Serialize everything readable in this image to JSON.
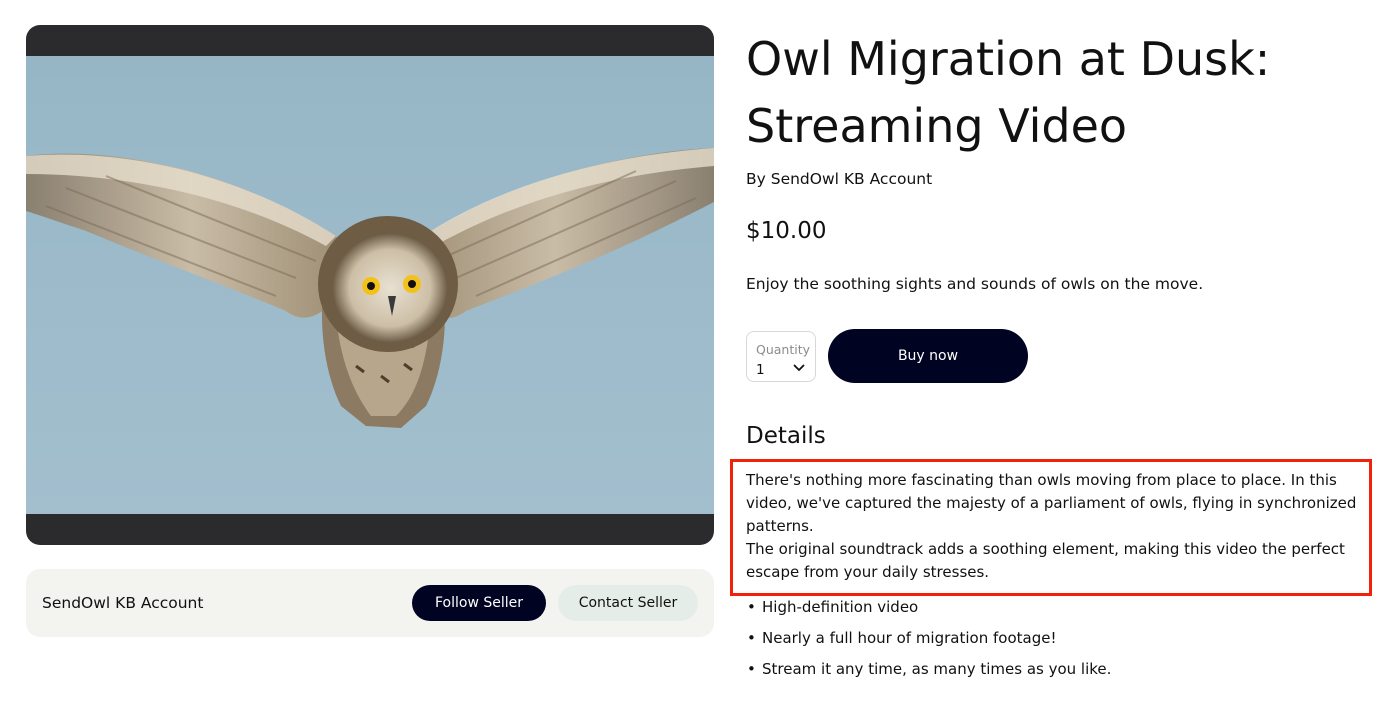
{
  "product": {
    "title": "Owl Migration at Dusk: Streaming Video",
    "byline": "By SendOwl KB Account",
    "price": "$10.00",
    "summary": "Enjoy the soothing sights and sounds of owls on the move."
  },
  "purchase": {
    "quantity_label": "Quantity",
    "quantity_value": "1",
    "buy_label": "Buy now"
  },
  "seller": {
    "name": "SendOwl KB Account",
    "follow_label": "Follow Seller",
    "contact_label": "Contact Seller"
  },
  "details": {
    "heading": "Details",
    "paragraphs": [
      "There's nothing more fascinating than owls moving from place to place. In this video, we've captured the majesty of a parliament of owls, flying in synchronized patterns.",
      "The original soundtrack adds a soothing element, making this video the perfect escape from your daily stresses."
    ],
    "features": [
      "High-definition video",
      "Nearly a full hour of migration footage!",
      "Stream it any time, as many times as you like."
    ],
    "highlight_color": "#f0230a"
  },
  "icons": {
    "quantity_chevron": "chevron-down-icon",
    "bullet": "•"
  },
  "colors": {
    "primary_button": "#000321",
    "secondary_button": "#e5ede8",
    "seller_card": "#f3f4ef",
    "video_frame": "#2b2b2d",
    "sky": "#9bb8c8"
  }
}
